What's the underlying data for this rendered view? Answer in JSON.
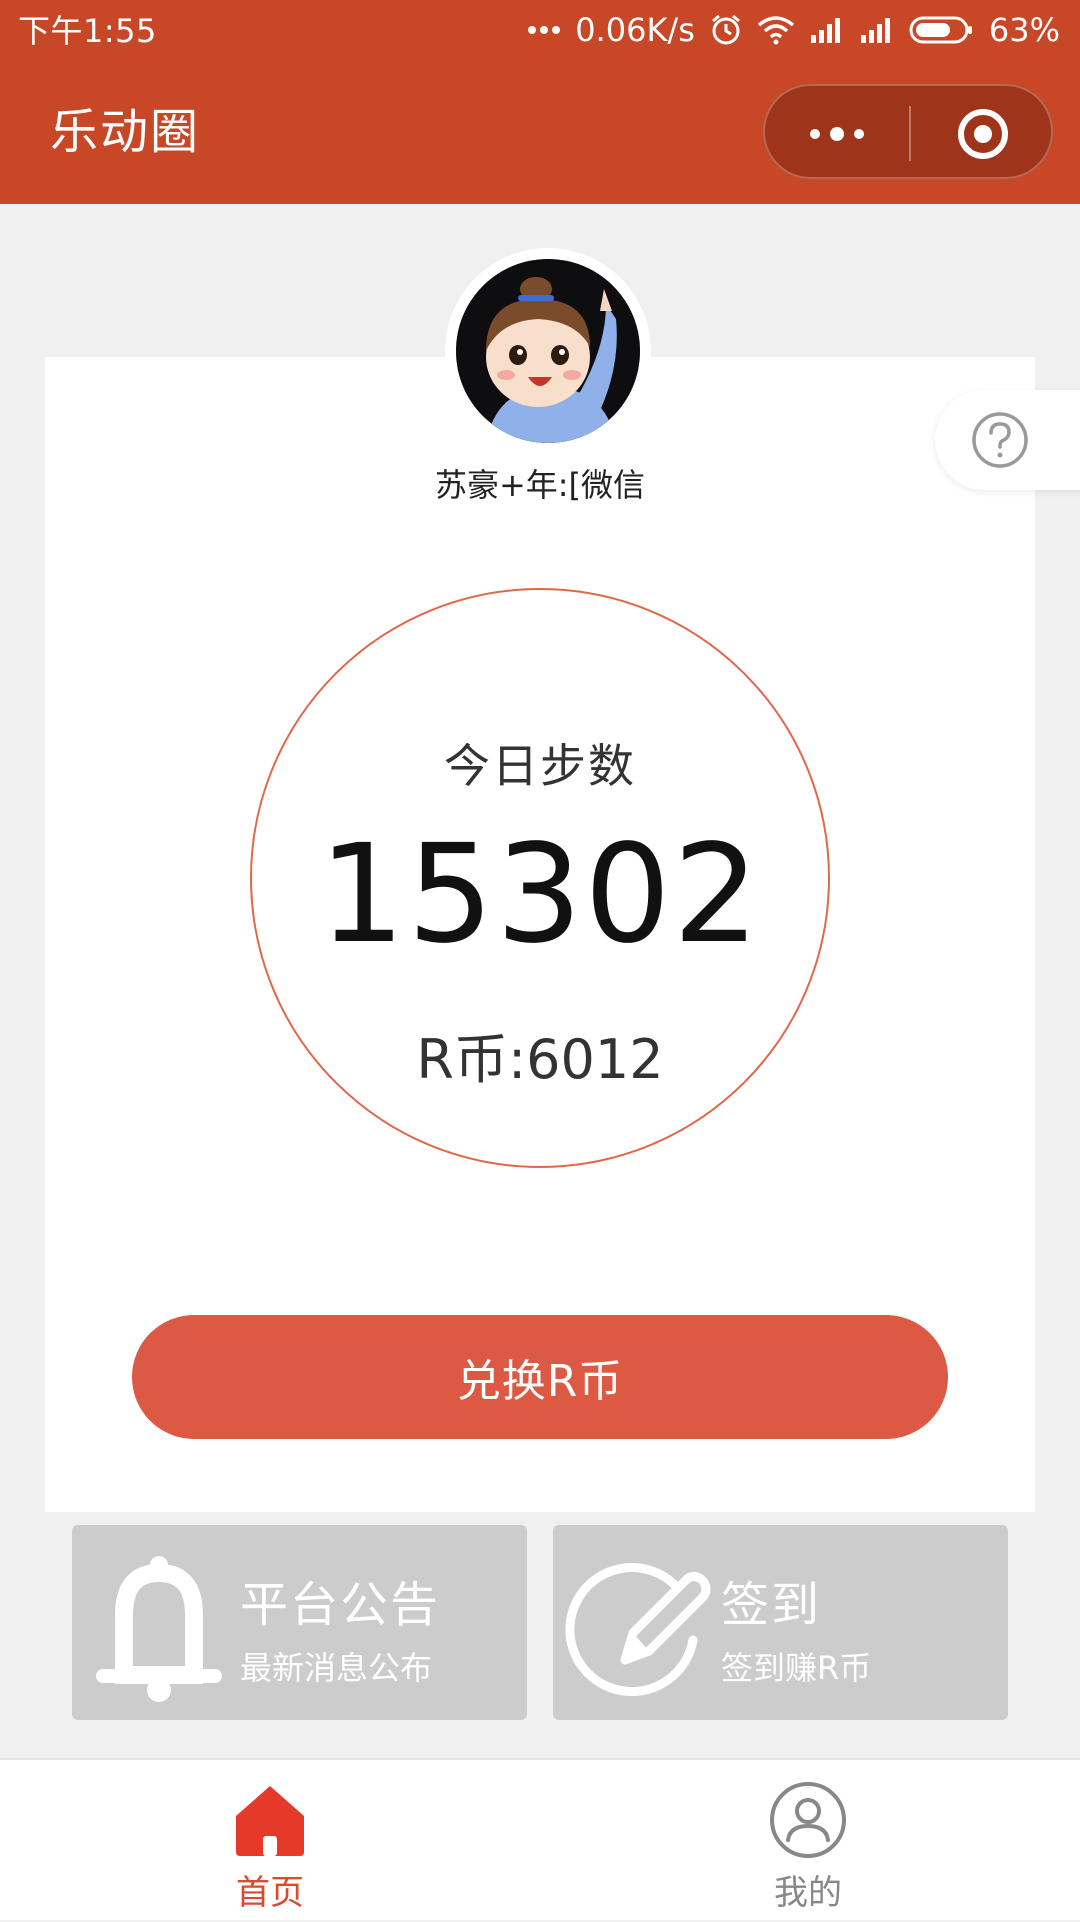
{
  "status_bar": {
    "time": "下午1:55",
    "network_speed": "0.06K/s",
    "battery": "63%",
    "icons": [
      "more-dots-icon",
      "alarm-icon",
      "wifi-icon",
      "signal-icon",
      "signal-icon",
      "battery-icon"
    ]
  },
  "header": {
    "title": "乐动圈",
    "background_color": "#c84726"
  },
  "profile": {
    "username": "苏豪+年:[微信"
  },
  "steps": {
    "label": "今日步数",
    "value": "15302",
    "coins": "R币:6012"
  },
  "actions": {
    "exchange_label": "兑换R币"
  },
  "tiles": [
    {
      "title": "平台公告",
      "subtitle": "最新消息公布",
      "icon": "bell-icon"
    },
    {
      "title": "签到",
      "subtitle": "签到赚R币",
      "icon": "sign-in-pen-icon"
    }
  ],
  "tabbar": {
    "items": [
      {
        "label": "首页",
        "icon": "home-icon",
        "active": true
      },
      {
        "label": "我的",
        "icon": "user-icon",
        "active": false
      }
    ]
  },
  "colors": {
    "accent": "#dc5943",
    "circle_border": "#e0684a",
    "tile_bg": "#cccccc"
  }
}
